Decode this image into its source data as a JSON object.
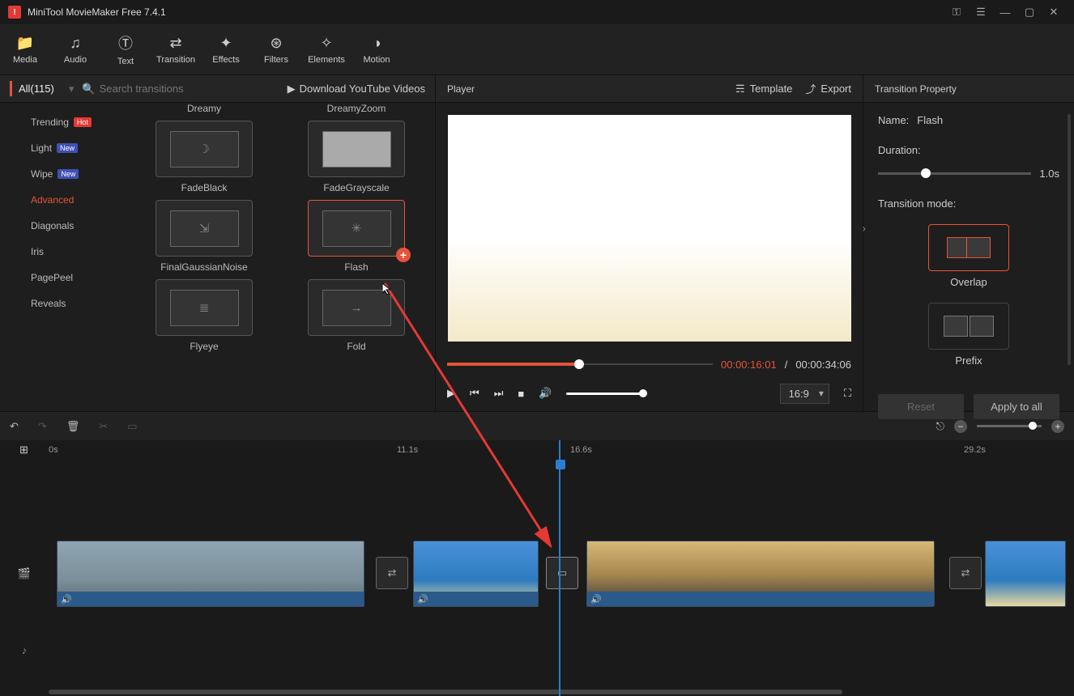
{
  "titlebar": {
    "title": "MiniTool MovieMaker Free 7.4.1"
  },
  "tools": {
    "media": "Media",
    "audio": "Audio",
    "text": "Text",
    "transition": "Transition",
    "effects": "Effects",
    "filters": "Filters",
    "elements": "Elements",
    "motion": "Motion"
  },
  "left": {
    "all_label": "All(115)",
    "search_placeholder": "Search transitions",
    "download_label": "Download YouTube Videos",
    "categories": [
      {
        "label": "Trending",
        "badge": "Hot",
        "badge_class": "badge-hot"
      },
      {
        "label": "Light",
        "badge": "New",
        "badge_class": "badge-new"
      },
      {
        "label": "Wipe",
        "badge": "New",
        "badge_class": "badge-new"
      },
      {
        "label": "Advanced",
        "active": true
      },
      {
        "label": "Diagonals"
      },
      {
        "label": "Iris"
      },
      {
        "label": "PagePeel"
      },
      {
        "label": "Reveals"
      }
    ],
    "thumbs": [
      "Dreamy",
      "DreamyZoom",
      "FadeBlack",
      "FadeGrayscale",
      "FinalGaussianNoise",
      "Flash",
      "Flyeye",
      "Fold"
    ]
  },
  "player": {
    "title": "Player",
    "template": "Template",
    "export": "Export",
    "time_current": "00:00:16:01",
    "time_sep": "/",
    "time_total": "00:00:34:06",
    "aspect": "16:9"
  },
  "props": {
    "title": "Transition Property",
    "name_label": "Name:",
    "name_value": "Flash",
    "duration_label": "Duration:",
    "duration_value": "1.0s",
    "mode_label": "Transition mode:",
    "mode_overlap": "Overlap",
    "mode_prefix": "Prefix",
    "reset": "Reset",
    "apply": "Apply to all"
  },
  "timeline": {
    "marks": [
      "0s",
      "11.1s",
      "16.6s",
      "29.2s"
    ]
  }
}
